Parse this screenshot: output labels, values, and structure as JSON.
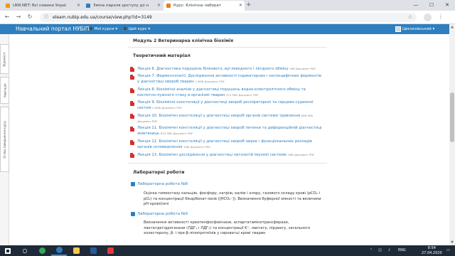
{
  "browser": {
    "tabs": [
      {
        "label": "UKR.NET: Всі новини Украї",
        "color": "#f29900",
        "active": false
      },
      {
        "label": "Зміна пароля доступу до н",
        "color": "#2d7fbf",
        "active": false
      },
      {
        "label": "Курс: Клінічна лаборат",
        "color": "#e67e22",
        "active": true
      }
    ],
    "new_tab": "+",
    "url": "eleam.nubip.edu.ua/course/view.php?id=3149",
    "window_controls": [
      "—",
      "☐",
      "✕"
    ]
  },
  "site": {
    "brand": "Навчальний портал НУБіП",
    "nav": [
      "Мої курси ▾",
      "Цей курс ▾"
    ],
    "user": "Цвєнковський ▾",
    "accent": "#2d7fbf"
  },
  "sidetabs": [
    "Відомості",
    "Навігація",
    "Огляд завершення курсу"
  ],
  "module_title": "Модуль 2 Ветеринарна клінічна біохімія",
  "theory": {
    "heading": "Теоретичний матеріал",
    "lectures": [
      {
        "title": "Лекція 6. Діагностика порушень білкового, вуглеводного і ліпідного обміну",
        "meta": "496 Документ PDF"
      },
      {
        "title": "Лекція 7. Ферментопатії. Дослідження активності індикаторних і неспецифічних ферментів у діагностиці хвороб тварин",
        "meta": "1.9МБ Документ PDF"
      },
      {
        "title": "Лекція 8. Біохімічні аналізи у діагностиці порушень водно-електролітного обміну та кислотно-лужного стану в організмі тварин",
        "meta": "372.9КБ Документ PDF"
      },
      {
        "title": "Лекція 9. Біохімічні констеляції у діагностиці хвороб респіраторної та серцево-судинної систем",
        "meta": "2.5МБ Документ PDF"
      },
      {
        "title": "Лекція 10. Біохімічні констеляції у діагностиці хвороб органів системи травлення",
        "meta": "869.3КБ Документ PDF"
      },
      {
        "title": "Лекція 11. Біохімічні констеляції у діагностиці хвороб печінки та диференційній діагностиці жовтяниць",
        "meta": "810.3КБ Документ PDF"
      },
      {
        "title": "Лекція 12. Біохімічні констеляції у діагностиці хвороб нирок і функціональних розладів органів сечовиділення",
        "meta": "1МБ Документ PDF"
      },
      {
        "title": "Лекція 13. Біохімічні дослідження у діагностиці патологій імунної системи",
        "meta": "1МБ Документ PDF"
      }
    ]
  },
  "labs": {
    "heading": "Лабораторні роботи",
    "items": [
      {
        "title": "Лабораторна робота №8",
        "desc": "Оцінка гомеостазу кальцію, фосфору, натрію, калію і хлору, газового складу крові (рCO₂ і pO₂) та концентрації бікарбонат-іонів ([HCO₃⁻]). Визначення буферної ємності та величини pH крові/сечі"
      },
      {
        "title": "Лабораторна робота №9",
        "desc": "Визначення активності креатинфосфокінази, аспартатамінотрансферази, лактатдегідрогенази (ЛДГ₁ і ЛДГ₂) та концентрації K⁺, лактату, пірувату, загального холестеролу, β- і пре-β-ліпопротеїнів у сироватці крові тварин"
      }
    ]
  },
  "taskbar": {
    "apps": [
      {
        "name": "start",
        "color": "#ffffff"
      },
      {
        "name": "search",
        "color": "#ffffff"
      },
      {
        "name": "taskview",
        "color": "#ffffff"
      },
      {
        "name": "edge",
        "color": "#3277bc"
      },
      {
        "name": "explorer",
        "color": "#f2c94c"
      },
      {
        "name": "chrome",
        "color": "#34a853"
      },
      {
        "name": "files",
        "color": "#f2c94c"
      },
      {
        "name": "mail",
        "color": "#2f80ed"
      },
      {
        "name": "folder",
        "color": "#e0b04a"
      },
      {
        "name": "word",
        "color": "#2b579a"
      },
      {
        "name": "acrobat",
        "color": "#e53935"
      }
    ],
    "lang": "ENG",
    "time": "8:54",
    "date": "27.04.2020"
  }
}
